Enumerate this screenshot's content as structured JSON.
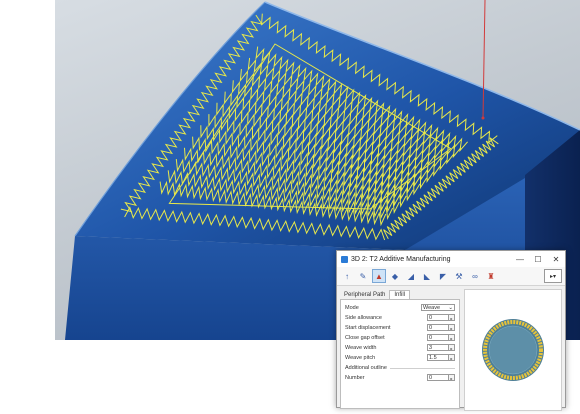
{
  "dialog": {
    "title": "3D 2: T2 Additive Manufacturing",
    "minimize": "—",
    "maximize": "☐",
    "close": "✕",
    "tabs": [
      {
        "label": "Peripheral Path"
      },
      {
        "label": "Infill"
      }
    ],
    "fields": [
      {
        "label": "Mode",
        "value": "Weave"
      },
      {
        "label": "Side allowance",
        "value": "0"
      },
      {
        "label": "Start displacement",
        "value": "0"
      },
      {
        "label": "Close gap offset",
        "value": "0"
      },
      {
        "label": "Weave width",
        "value": "3"
      },
      {
        "label": "Weave pitch",
        "value": "1.5"
      }
    ],
    "additional_outline": {
      "label": "Additional outline",
      "number_label": "Number",
      "number_value": "0"
    }
  },
  "colors": {
    "toolpath": "#e8e84a",
    "surface": "#1f55a8",
    "probe_line": "#d23b3b",
    "preview_ring": "#e6c33a",
    "preview_core": "#5d8fa8"
  }
}
